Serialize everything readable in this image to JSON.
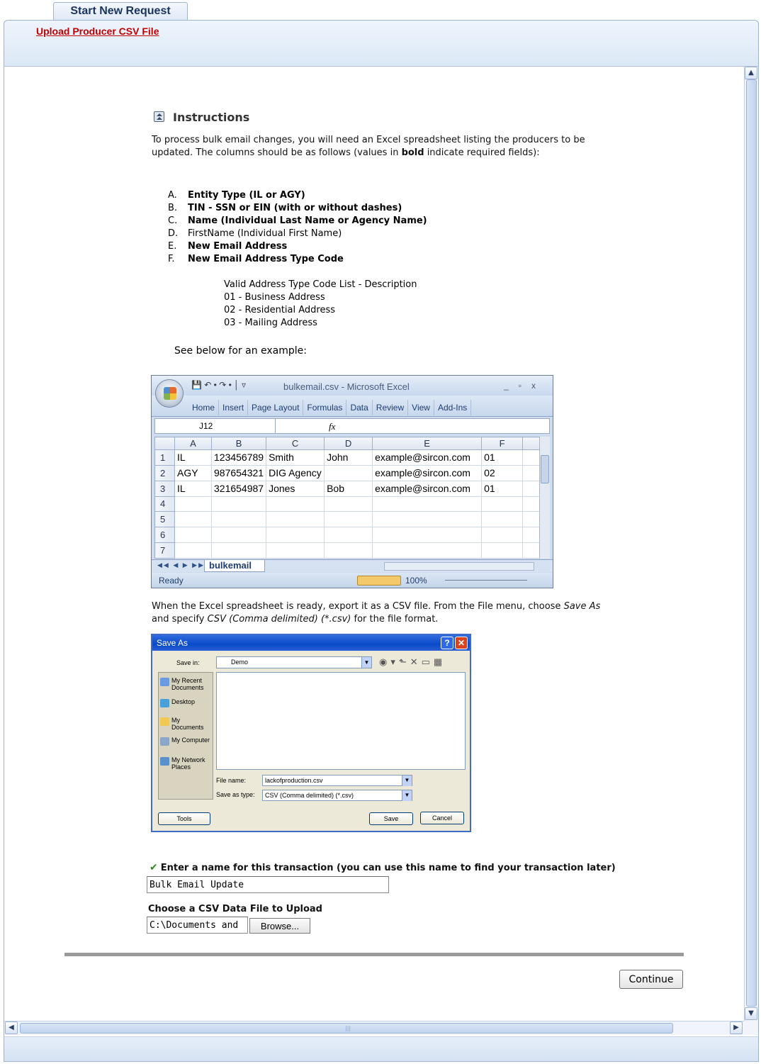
{
  "tab": {
    "label": "Start New Request"
  },
  "header": {
    "link": "Upload Producer CSV File"
  },
  "instructions": {
    "heading": "Instructions",
    "intro_1": "To process bulk email changes, you will need an Excel spreadsheet listing the producers to be updated. The columns should be as follows (values in ",
    "intro_bold": "bold",
    "intro_2": " indicate required fields):",
    "columns": [
      {
        "letter": "A.",
        "text": "Entity Type (IL or AGY)",
        "bold": true
      },
      {
        "letter": "B.",
        "text": "TIN - SSN or EIN (with or without dashes)",
        "bold": true
      },
      {
        "letter": "C.",
        "text": "Name (Individual Last Name or Agency Name)",
        "bold": true
      },
      {
        "letter": "D.",
        "text": "FirstName (Individual First Name)",
        "bold": false
      },
      {
        "letter": "E.",
        "text": "New Email Address",
        "bold": true
      },
      {
        "letter": "F.",
        "text": "New Email Address Type Code",
        "bold": true
      }
    ],
    "codes": [
      "Valid Address Type Code List - Description",
      "01 - Business Address",
      "02 - Residential Address",
      "03 - Mailing Address"
    ],
    "see_below": "See below for an example:",
    "export_1": "When the Excel spreadsheet is ready, export it as a CSV file. From the File menu, choose ",
    "export_save_as": "Save As",
    "export_2": " and specify ",
    "export_csv": "CSV (Comma delimited) (*.csv)",
    "export_3": " for the file format."
  },
  "excel": {
    "title": "bulkemail.csv - Microsoft Excel",
    "qat": "💾 ↶ • ↷ • │ ▿",
    "ribbon_tabs": [
      "Home",
      "Insert",
      "Page Layout",
      "Formulas",
      "Data",
      "Review",
      "View",
      "Add-Ins"
    ],
    "name_box": "J12",
    "fx": "fx",
    "columns": [
      "A",
      "B",
      "C",
      "D",
      "E",
      "F"
    ],
    "rows": [
      {
        "n": "1",
        "cells": [
          "IL",
          "123456789",
          "Smith",
          "John",
          "example@sircon.com",
          "01"
        ]
      },
      {
        "n": "2",
        "cells": [
          "AGY",
          "987654321",
          "DIG Agency",
          "",
          "example@sircon.com",
          "02"
        ]
      },
      {
        "n": "3",
        "cells": [
          "IL",
          "321654987",
          "Jones",
          "Bob",
          "example@sircon.com",
          "01"
        ]
      },
      {
        "n": "4",
        "cells": [
          "",
          "",
          "",
          "",
          "",
          ""
        ]
      },
      {
        "n": "5",
        "cells": [
          "",
          "",
          "",
          "",
          "",
          ""
        ]
      },
      {
        "n": "6",
        "cells": [
          "",
          "",
          "",
          "",
          "",
          ""
        ]
      },
      {
        "n": "7",
        "cells": [
          "",
          "",
          "",
          "",
          "",
          ""
        ]
      }
    ],
    "sheet_tab": "bulkemail",
    "status": "Ready",
    "zoom": "100%"
  },
  "save_as": {
    "title": "Save As",
    "save_in_label": "Save in:",
    "save_in_value": "Demo",
    "places": [
      "My Recent Documents",
      "Desktop",
      "My Documents",
      "My Computer",
      "My Network Places"
    ],
    "file_name_label": "File name:",
    "file_name_value": "lackofproduction.csv",
    "save_type_label": "Save as type:",
    "save_type_value": "CSV (Comma delimited) (*.csv)",
    "tools": "Tools",
    "save": "Save",
    "cancel": "Cancel"
  },
  "form": {
    "name_label": "Enter a name for this transaction (you can use this name to find your transaction later)",
    "name_value": "Bulk Email Update",
    "file_label": "Choose a CSV Data File to Upload",
    "file_value": "C:\\Documents and",
    "browse": "Browse...",
    "continue": "Continue"
  },
  "colors": {
    "link": "#c00000",
    "header_bg": "#dce8f6",
    "border": "#9fb4d0",
    "check": "#2f8a1f"
  },
  "icons": {
    "instructions": "collapse-icon",
    "check": "checkmark-icon",
    "scroll_up": "arrow-up-icon",
    "scroll_down": "arrow-down-icon",
    "scroll_left": "arrow-left-icon",
    "scroll_right": "arrow-right-icon"
  }
}
